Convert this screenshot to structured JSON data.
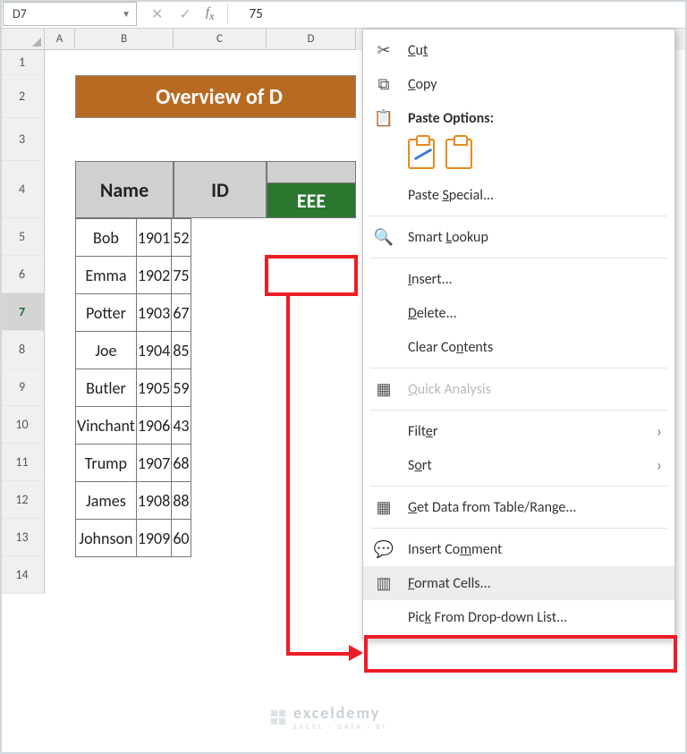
{
  "namebox": "D7",
  "formula_value": "75",
  "columns": {
    "A": "A",
    "B": "B",
    "C": "C",
    "D": "D"
  },
  "rows": [
    "1",
    "2",
    "3",
    "4",
    "5",
    "6",
    "7",
    "8",
    "9",
    "10",
    "11",
    "12",
    "13",
    "14"
  ],
  "title": "Overview of D",
  "headers": {
    "name": "Name",
    "id": "ID",
    "eee": "EEE"
  },
  "table": [
    {
      "name": "Bob",
      "id": "1901",
      "eee": "52"
    },
    {
      "name": "Emma",
      "id": "1902",
      "eee": "75"
    },
    {
      "name": "Potter",
      "id": "1903",
      "eee": "67"
    },
    {
      "name": "Joe",
      "id": "1904",
      "eee": "85"
    },
    {
      "name": "Butler",
      "id": "1905",
      "eee": "59"
    },
    {
      "name": "Vinchant",
      "id": "1906",
      "eee": "43"
    },
    {
      "name": "Trump",
      "id": "1907",
      "eee": "68"
    },
    {
      "name": "James",
      "id": "1908",
      "eee": "88"
    },
    {
      "name": "Johnson",
      "id": "1909",
      "eee": "60"
    }
  ],
  "ctx": {
    "cut": "Cut",
    "copy": "Copy",
    "paste_options": "Paste Options:",
    "paste_special": "Paste Special...",
    "smart_lookup": "Smart Lookup",
    "insert": "Insert...",
    "delete": "Delete...",
    "clear": "Clear Contents",
    "quick": "Quick Analysis",
    "filter": "Filter",
    "sort": "Sort",
    "get_data": "Get Data from Table/Range...",
    "comment": "Insert Comment",
    "format": "Format Cells...",
    "pick": "Pick From Drop-down List..."
  },
  "watermark": {
    "brand": "exceldemy",
    "tag": "EXCEL · DATA · BI"
  }
}
